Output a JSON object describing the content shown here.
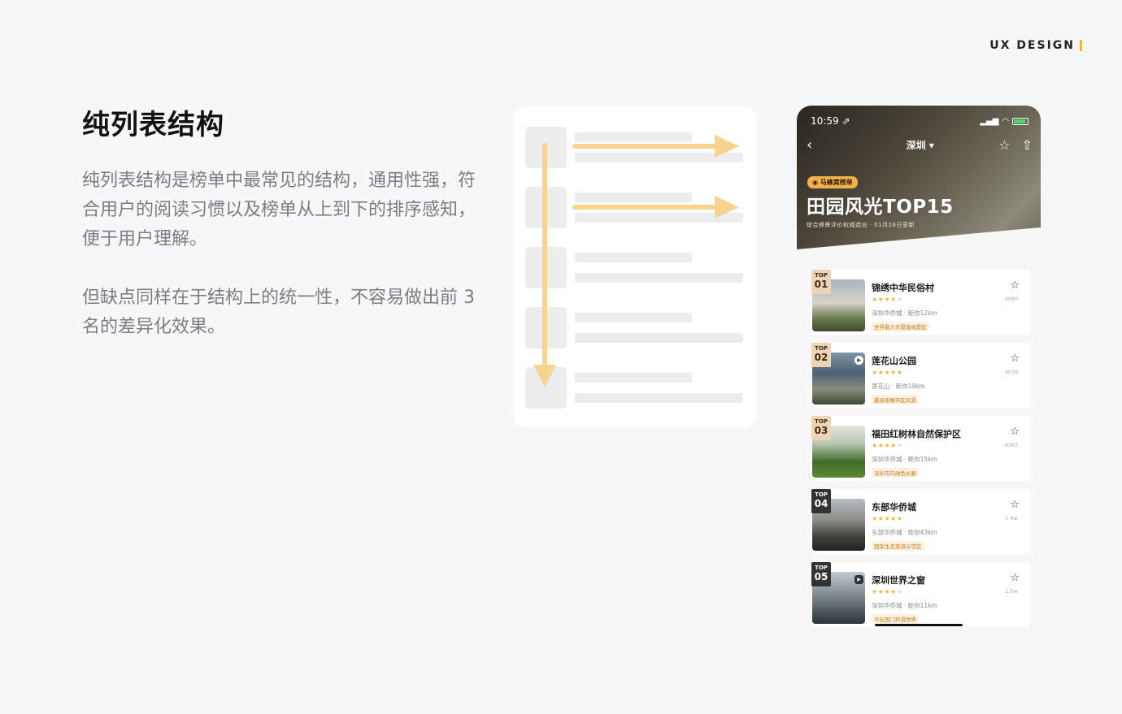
{
  "brand": {
    "label": "UX DESIGN",
    "accent": "#f3b33d"
  },
  "slide": {
    "title": "纯列表结构",
    "paragraph1": "纯列表结构是榜单中最常见的结构，通用性强，符合用户的阅读习惯以及榜单从上到下的排序感知，便于用户理解。",
    "paragraph2": "但缺点同样在于结构上的统一性，不容易做出前 3 名的差异化效果。"
  },
  "phone": {
    "status": {
      "time": "10:59 ⇗"
    },
    "nav": {
      "back": "‹",
      "city": "深圳 ▾",
      "star": "☆",
      "share": "⇧"
    },
    "hero": {
      "badge": "◉ 马蜂窝榜单",
      "title": "田园风光TOP15",
      "subtitle": "综合蜂蜂评价权威选出 · 01月26日更新"
    },
    "items": [
      {
        "top": "TOP",
        "rank": "01",
        "name": "锦绣中华民俗村",
        "stars_on": "★★★★",
        "stars_off": "★",
        "location": "深圳华侨城 · 距你12km",
        "tag": "世界最大实景微缩景区",
        "fav": "☆",
        "count": "4060"
      },
      {
        "top": "TOP",
        "rank": "02",
        "name": "莲花山公园",
        "stars_on": "★★★★★",
        "stars_off": "",
        "location": "莲花山 · 距你19km",
        "tag": "最高俯瞰市区风景",
        "fav": "☆",
        "count": "4056",
        "play": "▶"
      },
      {
        "top": "TOP",
        "rank": "03",
        "name": "福田红树林自然保护区",
        "stars_on": "★★★★",
        "stars_off": "★",
        "location": "深圳华侨城 · 距你15km",
        "tag": "深圳市内绿色长廊",
        "fav": "☆",
        "count": "4363"
      },
      {
        "top": "TOP",
        "rank": "04",
        "name": "东部华侨城",
        "stars_on": "★★★★★",
        "stars_off": "",
        "location": "东部华侨城 · 距你43km",
        "tag": "国家生态旅游示范区",
        "fav": "☆",
        "count": "1.4w"
      },
      {
        "top": "TOP",
        "rank": "05",
        "name": "深圳世界之窗",
        "stars_on": "★★★★",
        "stars_off": "★",
        "location": "深圳华侨城 · 距你11km",
        "tag": "不出国门环游世界",
        "fav": "☆",
        "count": "1.5w",
        "play": "▶"
      }
    ]
  }
}
